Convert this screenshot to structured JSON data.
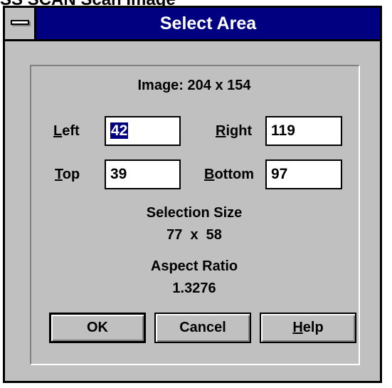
{
  "partial_top_text": "SS SCAN Scan Image",
  "window": {
    "title": "Select Area",
    "system_menu": "control-menu"
  },
  "image_info": {
    "text": "Image: 204 x 154"
  },
  "fields": {
    "left": {
      "mnemonic": "L",
      "label_rest": "eft",
      "value": "42",
      "selected": true
    },
    "right": {
      "mnemonic": "R",
      "label_rest": "ight",
      "value": "119"
    },
    "top": {
      "mnemonic": "T",
      "label_rest": "op",
      "value": "39"
    },
    "bottom": {
      "mnemonic": "B",
      "label_rest": "ottom",
      "value": "97"
    }
  },
  "selection": {
    "heading": "Selection Size",
    "value": "77  x  58"
  },
  "aspect": {
    "heading": "Aspect Ratio",
    "value": "1.3276"
  },
  "buttons": {
    "ok": "OK",
    "cancel": "Cancel",
    "help_mnemonic": "H",
    "help_rest": "elp"
  },
  "colors": {
    "titlebar": "#000080",
    "face": "#c0c0c0",
    "selection_highlight": "#000080"
  }
}
